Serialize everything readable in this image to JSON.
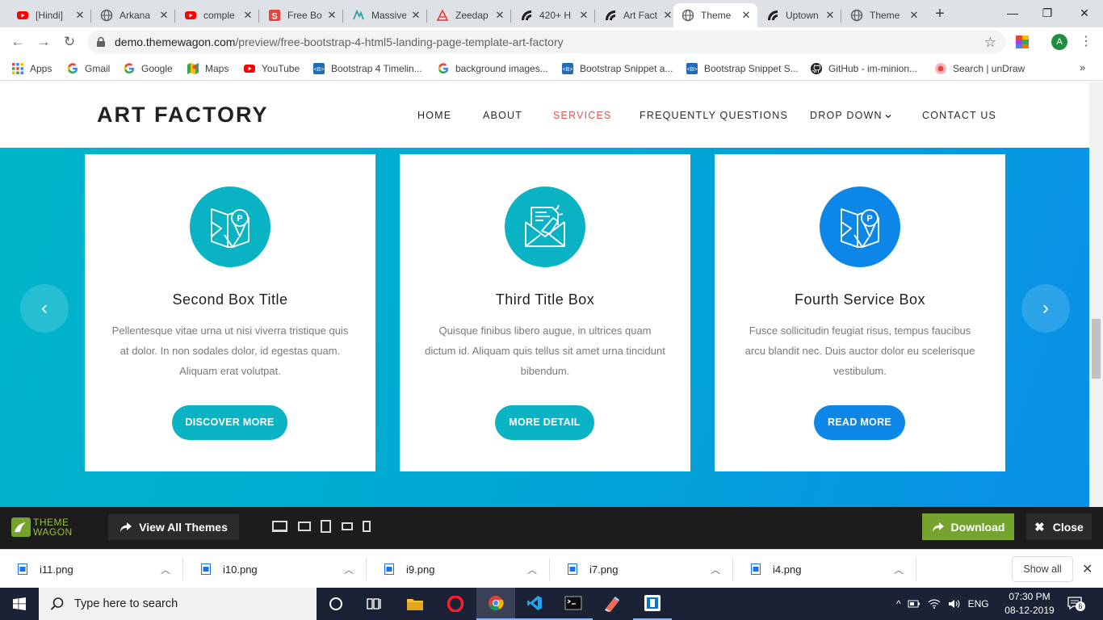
{
  "browser": {
    "tabs": [
      {
        "title": "[Hindi]",
        "icon": "youtube-icon",
        "active": false
      },
      {
        "title": "Arkana",
        "icon": "globe-icon",
        "active": false
      },
      {
        "title": "comple",
        "icon": "youtube-icon",
        "active": false
      },
      {
        "title": "Free Bo",
        "icon": "s-logo-icon",
        "active": false
      },
      {
        "title": "Massive",
        "icon": "massive-logo-icon",
        "active": false
      },
      {
        "title": "Zeedap",
        "icon": "zeedap-logo-icon",
        "active": false
      },
      {
        "title": "420+ H",
        "icon": "themewagon-icon",
        "active": false
      },
      {
        "title": "Art Fact",
        "icon": "themewagon-icon",
        "active": false
      },
      {
        "title": "Theme",
        "icon": "globe-icon",
        "active": true
      },
      {
        "title": "Uptown",
        "icon": "themewagon-icon",
        "active": false
      },
      {
        "title": "Theme",
        "icon": "globe-icon",
        "active": false
      }
    ],
    "url_host": "demo.themewagon.com",
    "url_path": "/preview/free-bootstrap-4-html5-landing-page-template-art-factory",
    "profile_initial": "A",
    "bookmarks": [
      {
        "label": "Apps",
        "icon": "apps-grid-icon"
      },
      {
        "label": "Gmail",
        "icon": "google-g-icon"
      },
      {
        "label": "Google",
        "icon": "google-g-icon"
      },
      {
        "label": "Maps",
        "icon": "maps-icon"
      },
      {
        "label": "YouTube",
        "icon": "youtube-icon"
      },
      {
        "label": "Bootstrap 4 Timelin...",
        "icon": "bootstrap-snippet-icon"
      },
      {
        "label": "background images...",
        "icon": "google-g-icon"
      },
      {
        "label": "Bootstrap Snippet a...",
        "icon": "bootstrap-snippet-icon"
      },
      {
        "label": "Bootstrap Snippet S...",
        "icon": "bootstrap-snippet-icon"
      },
      {
        "label": "GitHub - im-minion...",
        "icon": "github-icon"
      },
      {
        "label": "Search | unDraw",
        "icon": "undraw-icon"
      }
    ],
    "bookmarks_overflow": "»"
  },
  "site": {
    "logo": "ART FACTORY",
    "nav": [
      {
        "label": "HOME",
        "active": false
      },
      {
        "label": "ABOUT",
        "active": false
      },
      {
        "label": "SERVICES",
        "active": true
      },
      {
        "label": "FREQUENTLY QUESTIONS",
        "active": false
      },
      {
        "label": "DROP DOWN",
        "active": false,
        "has_dropdown": true
      },
      {
        "label": "CONTACT US",
        "active": false
      }
    ],
    "services": [
      {
        "title": "Second Box Title",
        "desc": "Pellentesque vitae urna ut nisi viverra tristique quis at dolor. In non sodales dolor, id egestas quam. Aliquam erat volutpat.",
        "button": "DISCOVER MORE",
        "icon": "map-pin-icon",
        "color": "#0ab3c4"
      },
      {
        "title": "Third Title Box",
        "desc": "Quisque finibus libero augue, in ultrices quam dictum id. Aliquam quis tellus sit amet urna tincidunt bibendum.",
        "button": "MORE DETAIL",
        "icon": "envelope-megaphone-icon",
        "color": "#0ab3c4"
      },
      {
        "title": "Fourth Service Box",
        "desc": "Fusce sollicitudin feugiat risus, tempus faucibus arcu blandit nec. Duis auctor dolor eu scelerisque vestibulum.",
        "button": "READ MORE",
        "icon": "map-pin-icon",
        "color": "#0c87e8"
      }
    ],
    "prev_arrow": "‹",
    "next_arrow": "›"
  },
  "themewagon_bar": {
    "logo_line1": "THEME",
    "logo_line2": "WAGON",
    "view_all": "View All Themes",
    "download": "Download",
    "close": "Close",
    "brand_color": "#74a42d"
  },
  "downloads": {
    "files": [
      "i11.png",
      "i10.png",
      "i9.png",
      "i7.png",
      "i4.png"
    ],
    "show_all": "Show all"
  },
  "taskbar": {
    "search_placeholder": "Type here to search",
    "language": "ENG",
    "time": "07:30 PM",
    "date": "08-12-2019",
    "notification_count": "6"
  }
}
